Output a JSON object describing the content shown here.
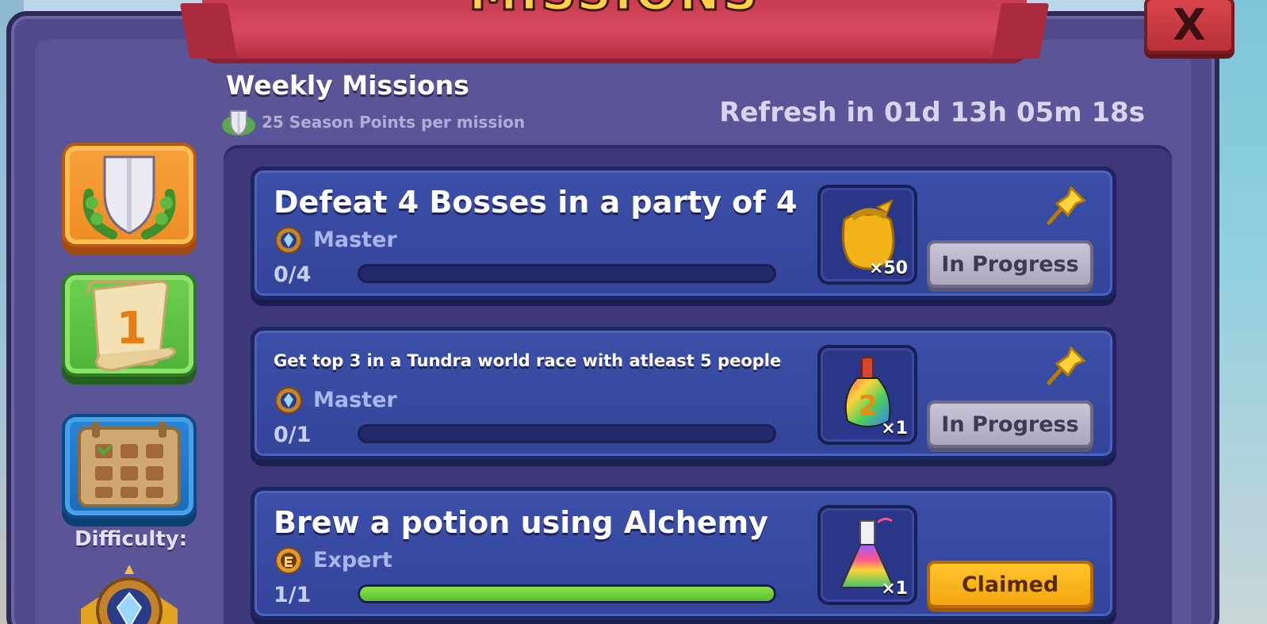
{
  "header": {
    "banner_title": "MISSIONS",
    "close_label": "X",
    "weekly_title": "Weekly Missions",
    "season_points": "25 Season Points per mission",
    "refresh": "Refresh in 01d 13h 05m 18s"
  },
  "sidebar": {
    "difficulty_label": "Difficulty:",
    "tabs": [
      {
        "name": "season-points",
        "icon": "shield-icon"
      },
      {
        "name": "weekly",
        "icon": "scroll-icon",
        "number": "1"
      },
      {
        "name": "calendar",
        "icon": "calendar-icon"
      }
    ]
  },
  "missions": [
    {
      "title": "Defeat 4 Bosses in a party of 4",
      "difficulty": "Master",
      "progress_text": "0/4",
      "progress": 0,
      "reward_icon": "gold-pouch-icon",
      "reward_count": "×50",
      "status": "In Progress",
      "pinned": true
    },
    {
      "title": "Get top 3 in a Tundra world race with atleast 5 people",
      "difficulty": "Master",
      "progress_text": "0/1",
      "progress": 0,
      "reward_icon": "rainbow-bottle-icon",
      "reward_count": "×1",
      "status": "In Progress",
      "pinned": true
    },
    {
      "title": "Brew a potion using Alchemy",
      "difficulty": "Expert",
      "progress_text": "1/1",
      "progress": 1,
      "reward_icon": "rainbow-flask-icon",
      "reward_count": "×1",
      "status": "Claimed",
      "pinned": false
    }
  ],
  "colors": {
    "panel": "#4f4a8a",
    "card": "#3c4fa8",
    "banner": "#d9485b",
    "claimed": "#ffc52a",
    "progress_fill": "#57c22e"
  }
}
